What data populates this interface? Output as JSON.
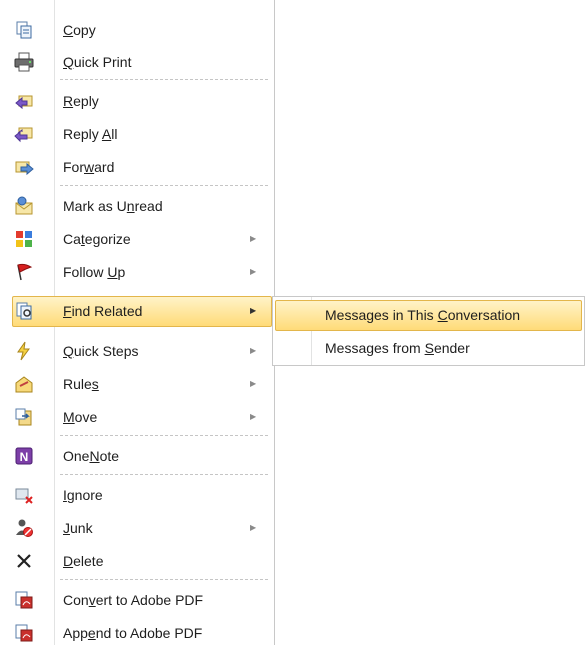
{
  "menu": {
    "items": [
      {
        "pre": "",
        "acc": "C",
        "post": "opy",
        "icon": "copy-icon"
      },
      {
        "pre": "",
        "acc": "Q",
        "post": "uick Print",
        "icon": "printer-icon"
      },
      {
        "pre": "",
        "acc": "R",
        "post": "eply",
        "icon": "reply-icon"
      },
      {
        "pre": "Reply ",
        "acc": "A",
        "post": "ll",
        "icon": "reply-all-icon"
      },
      {
        "pre": "For",
        "acc": "w",
        "post": "ard",
        "icon": "forward-icon"
      },
      {
        "pre": "Mark as U",
        "acc": "n",
        "post": "read",
        "icon": "mark-unread-icon"
      },
      {
        "pre": "Ca",
        "acc": "t",
        "post": "egorize",
        "icon": "categorize-icon"
      },
      {
        "pre": "Follow ",
        "acc": "U",
        "post": "p",
        "icon": "flag-icon"
      },
      {
        "pre": "",
        "acc": "F",
        "post": "ind Related",
        "icon": "find-related-icon"
      },
      {
        "pre": "",
        "acc": "Q",
        "post": "uick Steps",
        "icon": "quick-steps-icon"
      },
      {
        "pre": "Rule",
        "acc": "s",
        "post": "",
        "icon": "rules-icon"
      },
      {
        "pre": "",
        "acc": "M",
        "post": "ove",
        "icon": "move-icon"
      },
      {
        "pre": "One",
        "acc": "N",
        "post": "ote",
        "icon": "onenote-icon"
      },
      {
        "pre": "",
        "acc": "I",
        "post": "gnore",
        "icon": "ignore-icon"
      },
      {
        "pre": "",
        "acc": "J",
        "post": "unk",
        "icon": "junk-icon"
      },
      {
        "pre": "",
        "acc": "D",
        "post": "elete",
        "icon": "delete-icon"
      },
      {
        "pre": "Con",
        "acc": "v",
        "post": "ert to Adobe PDF",
        "icon": "convert-pdf-icon"
      },
      {
        "pre": "App",
        "acc": "e",
        "post": "nd to Adobe PDF",
        "icon": "append-pdf-icon"
      }
    ],
    "arrow_glyph": "▶",
    "highlight_color": "#ffdb78"
  },
  "submenu": {
    "items": [
      {
        "pre": "Messages in This ",
        "acc": "C",
        "post": "onversation"
      },
      {
        "pre": "Messages from ",
        "acc": "S",
        "post": "ender"
      }
    ]
  }
}
